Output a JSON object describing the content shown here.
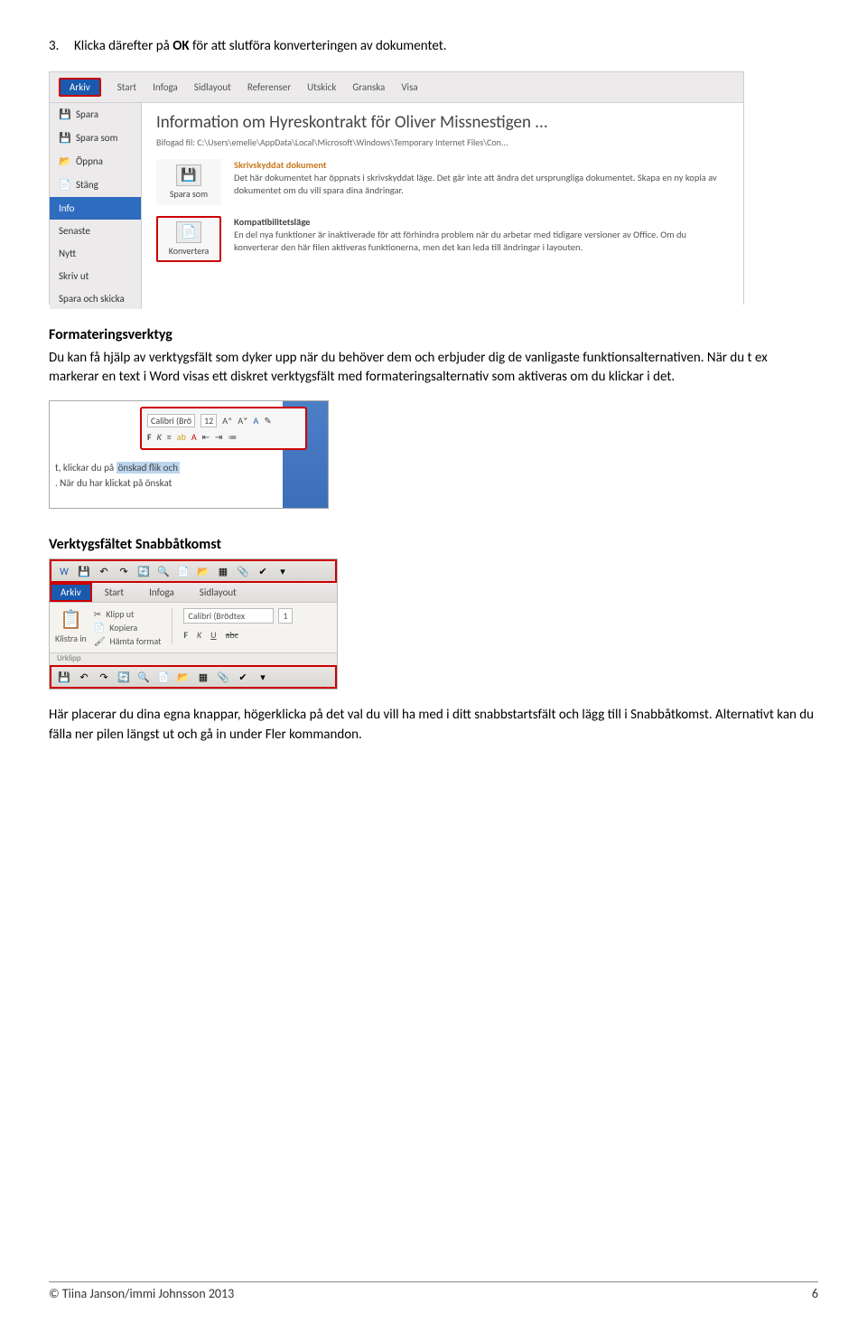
{
  "step3": {
    "num": "3.",
    "pre": "Klicka därefter på ",
    "bold": "OK",
    "post": " för att slutföra konverteringen av dokumentet."
  },
  "word_info": {
    "tabs": {
      "arkív": "Arkiv",
      "start": "Start",
      "infoga": "Infoga",
      "sidlayout": "Sidlayout",
      "referenser": "Referenser",
      "utskick": "Utskick",
      "granska": "Granska",
      "visa": "Visa"
    },
    "side": {
      "spara": "Spara",
      "spara_som": "Spara som",
      "oppna": "Öppna",
      "stang": "Stäng",
      "info": "Info",
      "senaste": "Senaste",
      "nytt": "Nytt",
      "skriv_ut": "Skriv ut",
      "spara_skicka": "Spara och skicka"
    },
    "title": "Information om Hyreskontrakt för Oliver Missnestigen ...",
    "path_label": "Bifogad fil:",
    "path": "C:\\Users\\emelie\\AppData\\Local\\Microsoft\\Windows\\Temporary Internet Files\\Con...",
    "spara_som_btn": "Spara som",
    "skriv_heading": "Skrivskyddat dokument",
    "skriv_body": "Det här dokumentet har öppnats i skrivskyddat läge. Det går inte att ändra det ursprungliga dokumentet. Skapa en ny kopia av dokumentet om du vill spara dina ändringar.",
    "konv_btn": "Konvertera",
    "komp_heading": "Kompatibilitetsläge",
    "komp_body": "En del nya funktioner är inaktiverade för att förhindra problem när du arbetar med tidigare versioner av Office. Om du konverterar den här filen aktiveras funktionerna, men det kan leda till ändringar i layouten."
  },
  "section1": {
    "heading": "Formateringsverktyg",
    "body": "Du kan få hjälp av verktygsfält som dyker upp när du behöver dem och erbjuder dig de vanligaste funktionsalternativen. När du t ex markerar en text i Word visas ett diskret verktygsfält med formateringsalternativ som aktiveras om du klickar i det."
  },
  "mini": {
    "font": "Calibri (Brö",
    "size": "12",
    "row2": {
      "b": "F",
      "i": "K"
    },
    "line1_pre": "t, klickar du på ",
    "line1_hl": "önskad flik och",
    "line2": ". När du har klickat på önskat"
  },
  "section2": {
    "heading": "Verktygsfältet Snabbåtkomst"
  },
  "qa": {
    "tabs": {
      "arkív": "Arkiv",
      "start": "Start",
      "infoga": "Infoga",
      "sidlayout": "Sidlayout"
    },
    "klipp": "Klipp ut",
    "kopiera": "Kopiera",
    "hamta": "Hämta format",
    "klistra": "Klistra in",
    "urklipp": "Urklipp",
    "font_input": "Calibri (Brödtex",
    "size_input": "1",
    "f": "F",
    "k": "K",
    "u": "U",
    "abc": "abc"
  },
  "section3": {
    "body": "Här placerar du dina egna knappar, högerklicka på det val du vill ha med i ditt snabbstartsfält och lägg till i Snabbåtkomst. Alternativt kan du fälla ner pilen längst ut och gå in under Fler kommandon."
  },
  "footer": {
    "left": "© Tiina Janson/immi Johnsson 2013",
    "right": "6"
  }
}
